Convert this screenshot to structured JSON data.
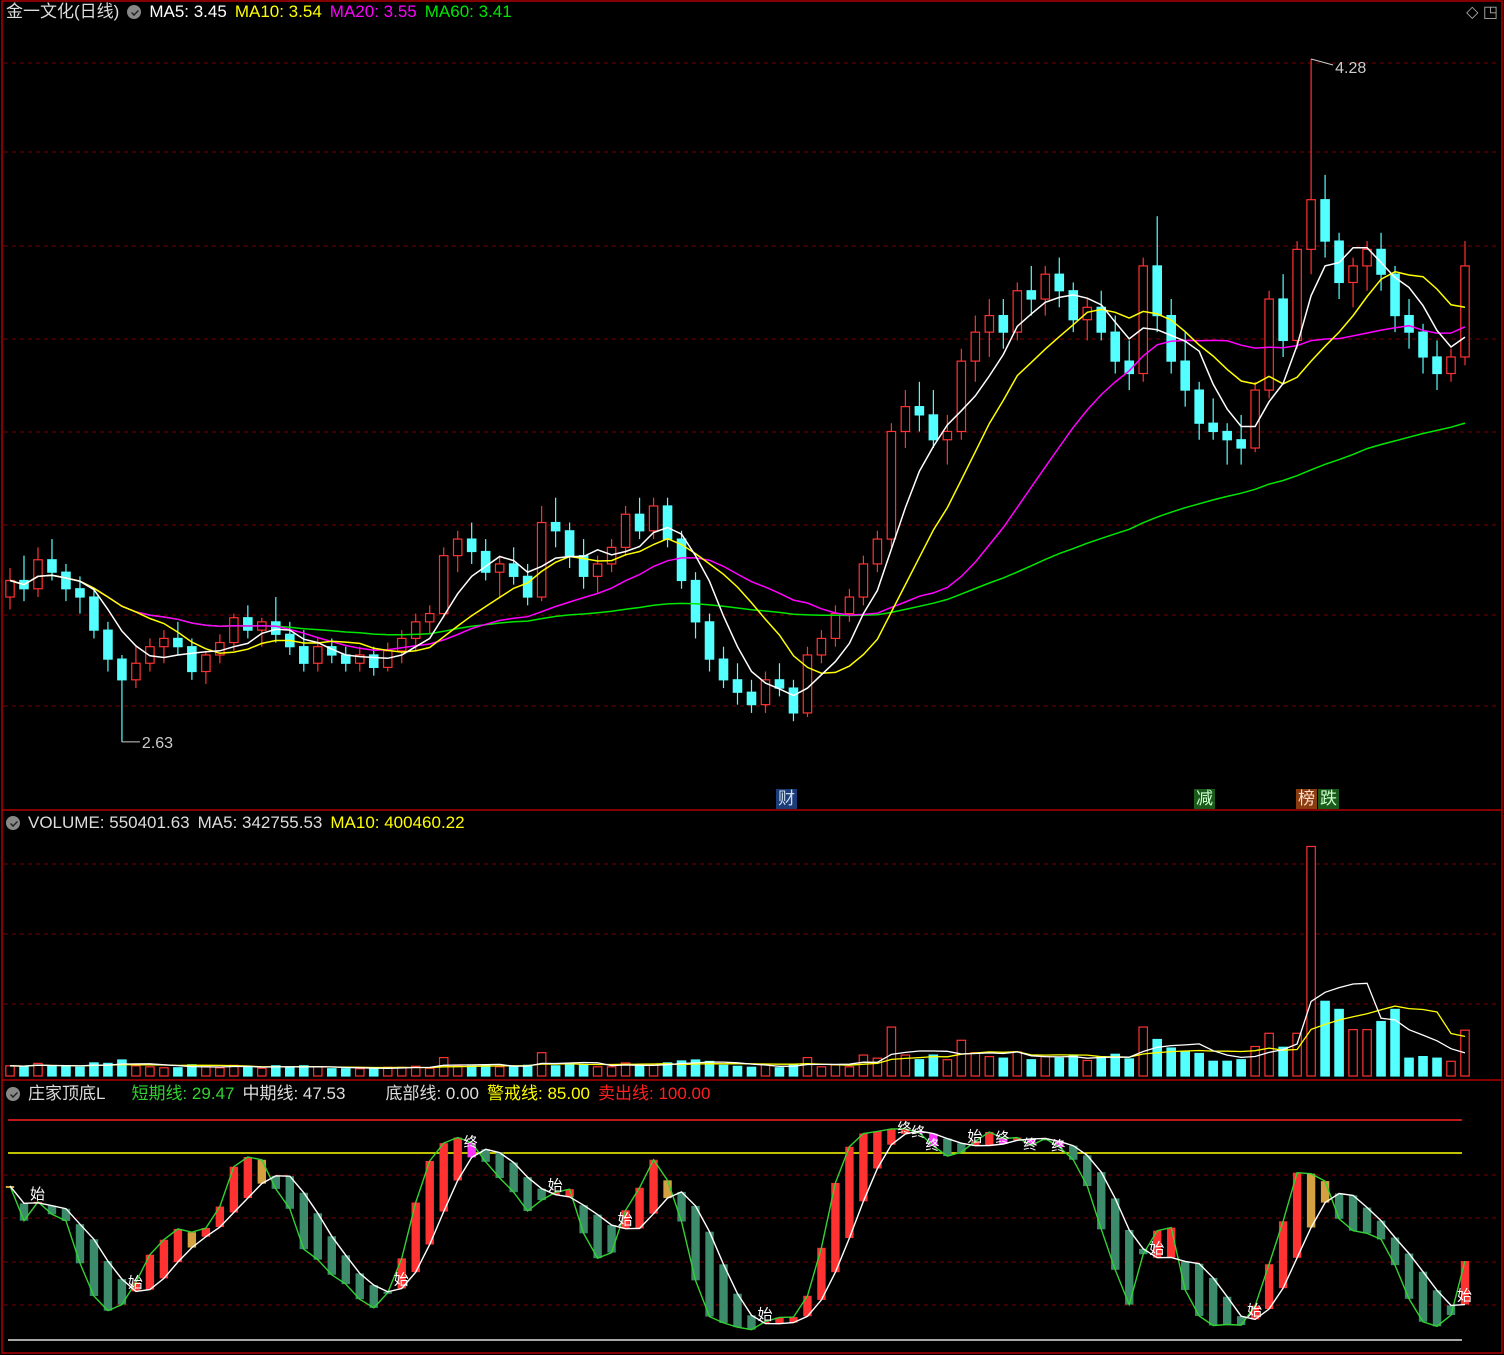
{
  "panel1": {
    "title": "金一文化(日线)",
    "ma5_label": "MA5: 3.45",
    "ma10_label": "MA10: 3.54",
    "ma20_label": "MA20: 3.55",
    "ma60_label": "MA60: 3.41",
    "high_marker": "4.28",
    "low_marker": "2.63",
    "tags": [
      "财",
      "减",
      "榜",
      "跌"
    ]
  },
  "panel2": {
    "volume_label": "VOLUME: 550401.63",
    "ma5_label": "MA5: 342755.53",
    "ma10_label": "MA10: 400460.22"
  },
  "panel3": {
    "title": "庄家顶底L",
    "short_label": "短期线: 29.47",
    "mid_label": "中期线: 47.53",
    "bottom_label": "底部线: 0.00",
    "warn_label": "警戒线: 85.00",
    "sell_label": "卖出线: 100.00",
    "start_mark": "始",
    "end_mark": "终"
  },
  "colors": {
    "up": "#ff3232",
    "down": "#54ffff",
    "ma5": "#ffffff",
    "ma10": "#ffff00",
    "ma20": "#ff00ff",
    "ma60": "#00e600",
    "grid": "#7a0000",
    "frame": "#b00000",
    "warn_line": "#ffff00",
    "sell_line": "#ff2020",
    "orange": "#d4a040",
    "teal": "#3c8c6c"
  },
  "chart_data": [
    {
      "type": "candlestick",
      "title": "金一文化(日线)",
      "ylim": [
        2.55,
        4.35
      ],
      "price_high": 4.28,
      "price_low": 2.63,
      "candles": [
        [
          2.98,
          3.05,
          2.95,
          3.02
        ],
        [
          3.02,
          3.08,
          2.97,
          3.0
        ],
        [
          3.0,
          3.1,
          2.98,
          3.07
        ],
        [
          3.07,
          3.12,
          3.02,
          3.04
        ],
        [
          3.04,
          3.06,
          2.97,
          3.0
        ],
        [
          3.0,
          3.03,
          2.94,
          2.98
        ],
        [
          2.98,
          3.0,
          2.88,
          2.9
        ],
        [
          2.9,
          2.92,
          2.8,
          2.83
        ],
        [
          2.83,
          2.84,
          2.63,
          2.78
        ],
        [
          2.78,
          2.86,
          2.76,
          2.82
        ],
        [
          2.82,
          2.88,
          2.8,
          2.86
        ],
        [
          2.86,
          2.9,
          2.82,
          2.88
        ],
        [
          2.88,
          2.92,
          2.84,
          2.86
        ],
        [
          2.86,
          2.88,
          2.78,
          2.8
        ],
        [
          2.8,
          2.85,
          2.77,
          2.84
        ],
        [
          2.84,
          2.89,
          2.82,
          2.87
        ],
        [
          2.87,
          2.94,
          2.85,
          2.93
        ],
        [
          2.93,
          2.96,
          2.88,
          2.9
        ],
        [
          2.9,
          2.93,
          2.86,
          2.92
        ],
        [
          2.92,
          2.98,
          2.87,
          2.89
        ],
        [
          2.89,
          2.92,
          2.84,
          2.86
        ],
        [
          2.86,
          2.9,
          2.8,
          2.82
        ],
        [
          2.82,
          2.88,
          2.8,
          2.86
        ],
        [
          2.86,
          2.88,
          2.82,
          2.84
        ],
        [
          2.84,
          2.86,
          2.8,
          2.82
        ],
        [
          2.82,
          2.86,
          2.8,
          2.84
        ],
        [
          2.84,
          2.86,
          2.79,
          2.81
        ],
        [
          2.81,
          2.87,
          2.8,
          2.85
        ],
        [
          2.85,
          2.9,
          2.82,
          2.88
        ],
        [
          2.88,
          2.94,
          2.85,
          2.92
        ],
        [
          2.92,
          2.96,
          2.89,
          2.94
        ],
        [
          2.94,
          3.1,
          2.93,
          3.08
        ],
        [
          3.08,
          3.14,
          3.04,
          3.12
        ],
        [
          3.12,
          3.16,
          3.06,
          3.09
        ],
        [
          3.09,
          3.12,
          3.02,
          3.04
        ],
        [
          3.04,
          3.08,
          2.98,
          3.06
        ],
        [
          3.06,
          3.1,
          3.01,
          3.03
        ],
        [
          3.03,
          3.06,
          2.96,
          2.98
        ],
        [
          2.98,
          3.2,
          2.97,
          3.16
        ],
        [
          3.16,
          3.22,
          3.1,
          3.14
        ],
        [
          3.14,
          3.16,
          3.05,
          3.08
        ],
        [
          3.08,
          3.12,
          3.0,
          3.03
        ],
        [
          3.03,
          3.08,
          2.99,
          3.06
        ],
        [
          3.06,
          3.12,
          3.04,
          3.1
        ],
        [
          3.1,
          3.2,
          3.08,
          3.18
        ],
        [
          3.18,
          3.22,
          3.12,
          3.14
        ],
        [
          3.14,
          3.22,
          3.12,
          3.2
        ],
        [
          3.2,
          3.22,
          3.1,
          3.12
        ],
        [
          3.12,
          3.14,
          3.0,
          3.02
        ],
        [
          3.02,
          3.04,
          2.88,
          2.92
        ],
        [
          2.92,
          2.94,
          2.8,
          2.83
        ],
        [
          2.83,
          2.86,
          2.76,
          2.78
        ],
        [
          2.78,
          2.82,
          2.72,
          2.75
        ],
        [
          2.75,
          2.78,
          2.7,
          2.72
        ],
        [
          2.72,
          2.8,
          2.7,
          2.78
        ],
        [
          2.78,
          2.82,
          2.74,
          2.76
        ],
        [
          2.76,
          2.78,
          2.68,
          2.7
        ],
        [
          2.7,
          2.86,
          2.69,
          2.84
        ],
        [
          2.84,
          2.9,
          2.82,
          2.88
        ],
        [
          2.88,
          2.96,
          2.86,
          2.94
        ],
        [
          2.94,
          3.0,
          2.92,
          2.98
        ],
        [
          2.98,
          3.08,
          2.96,
          3.06
        ],
        [
          3.06,
          3.14,
          3.04,
          3.12
        ],
        [
          3.12,
          3.4,
          3.1,
          3.38
        ],
        [
          3.38,
          3.48,
          3.34,
          3.44
        ],
        [
          3.44,
          3.5,
          3.38,
          3.42
        ],
        [
          3.42,
          3.48,
          3.34,
          3.36
        ],
        [
          3.36,
          3.42,
          3.3,
          3.38
        ],
        [
          3.38,
          3.58,
          3.36,
          3.55
        ],
        [
          3.55,
          3.66,
          3.5,
          3.62
        ],
        [
          3.62,
          3.7,
          3.56,
          3.66
        ],
        [
          3.66,
          3.7,
          3.58,
          3.62
        ],
        [
          3.62,
          3.74,
          3.6,
          3.72
        ],
        [
          3.72,
          3.78,
          3.66,
          3.7
        ],
        [
          3.7,
          3.78,
          3.66,
          3.76
        ],
        [
          3.76,
          3.8,
          3.68,
          3.72
        ],
        [
          3.72,
          3.74,
          3.62,
          3.65
        ],
        [
          3.65,
          3.7,
          3.6,
          3.68
        ],
        [
          3.68,
          3.72,
          3.6,
          3.62
        ],
        [
          3.62,
          3.66,
          3.52,
          3.55
        ],
        [
          3.55,
          3.6,
          3.48,
          3.52
        ],
        [
          3.52,
          3.8,
          3.5,
          3.78
        ],
        [
          3.78,
          3.9,
          3.62,
          3.66
        ],
        [
          3.66,
          3.7,
          3.52,
          3.55
        ],
        [
          3.55,
          3.62,
          3.44,
          3.48
        ],
        [
          3.48,
          3.5,
          3.36,
          3.4
        ],
        [
          3.4,
          3.46,
          3.36,
          3.38
        ],
        [
          3.38,
          3.4,
          3.3,
          3.36
        ],
        [
          3.36,
          3.42,
          3.3,
          3.34
        ],
        [
          3.34,
          3.5,
          3.33,
          3.48
        ],
        [
          3.48,
          3.72,
          3.46,
          3.7
        ],
        [
          3.7,
          3.76,
          3.56,
          3.6
        ],
        [
          3.6,
          3.84,
          3.58,
          3.82
        ],
        [
          3.82,
          4.28,
          3.76,
          3.94
        ],
        [
          3.94,
          4.0,
          3.8,
          3.84
        ],
        [
          3.84,
          3.86,
          3.7,
          3.74
        ],
        [
          3.74,
          3.8,
          3.68,
          3.78
        ],
        [
          3.78,
          3.84,
          3.72,
          3.82
        ],
        [
          3.82,
          3.86,
          3.72,
          3.76
        ],
        [
          3.76,
          3.78,
          3.62,
          3.66
        ],
        [
          3.66,
          3.7,
          3.58,
          3.62
        ],
        [
          3.62,
          3.64,
          3.52,
          3.56
        ],
        [
          3.56,
          3.6,
          3.48,
          3.52
        ],
        [
          3.52,
          3.58,
          3.5,
          3.56
        ],
        [
          3.56,
          3.84,
          3.54,
          3.78
        ]
      ],
      "ma5_last": 3.45,
      "ma10_last": 3.54,
      "ma20_last": 3.55,
      "ma60_last": 3.41
    },
    {
      "type": "bar",
      "title": "VOLUME",
      "last_volume": 550401.63,
      "ma5_last": 342755.53,
      "ma10_last": 400460.22,
      "note_scale": "volume in shares, relative heights"
    },
    {
      "type": "line",
      "title": "庄家顶底L",
      "ylim": [
        0,
        100
      ],
      "short_last": 29.47,
      "mid_last": 47.53,
      "bottom_line": 0,
      "warn_line": 85,
      "sell_line": 100
    }
  ]
}
